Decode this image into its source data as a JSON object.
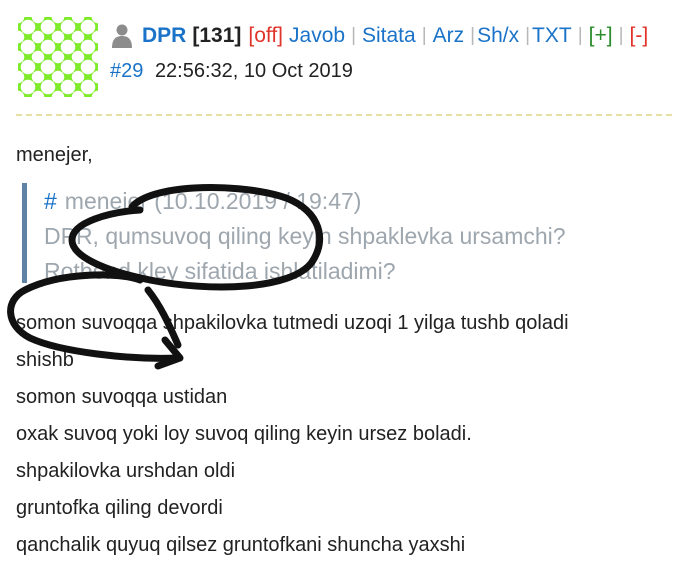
{
  "post": {
    "username": "DPR",
    "count": "[131]",
    "status": "[off]",
    "actions": {
      "reply": "Javob",
      "quote": "Sitata",
      "report": "Arz",
      "pm": "Sh/x",
      "txt": "TXT",
      "plus": "[+]",
      "minus": "[-]",
      "separator": "|"
    },
    "number": "#29",
    "datetime": "22:56:32, 10 Oct 2019"
  },
  "message": {
    "greeting": "menejer,",
    "quote": {
      "hash": "#",
      "meta": "menejer (10.10.2019 / 19:47)",
      "line1": "DPR, qumsuvoq qiling keyin shpaklevka ursamchi?",
      "line2": "Rotbond kley sifatida ishlatiladimi?"
    },
    "lines": [
      "somon suvoqqa shpakilovka tutmedi uzoqi 1 yilga tushb qoladi",
      "shishb",
      "somon suvoqqa ustidan",
      "oxak suvoq yoki loy suvoq qiling keyin ursez boladi.",
      "shpakilovka urshdan oldi",
      "gruntofka qiling devordi",
      "qanchalik quyuq qilsez gruntofkani shuncha yaxshi"
    ]
  },
  "icons": {
    "avatar": "avatar-pattern",
    "user": "user-icon"
  },
  "colors": {
    "link": "#1a73c8",
    "offline": "#e0342a",
    "plus": "#2a8c2a",
    "quote_text": "#9ea6ae",
    "quote_bar": "#5f82a6",
    "avatar_green": "#7dea2a",
    "divider": "#e6e0a6"
  }
}
